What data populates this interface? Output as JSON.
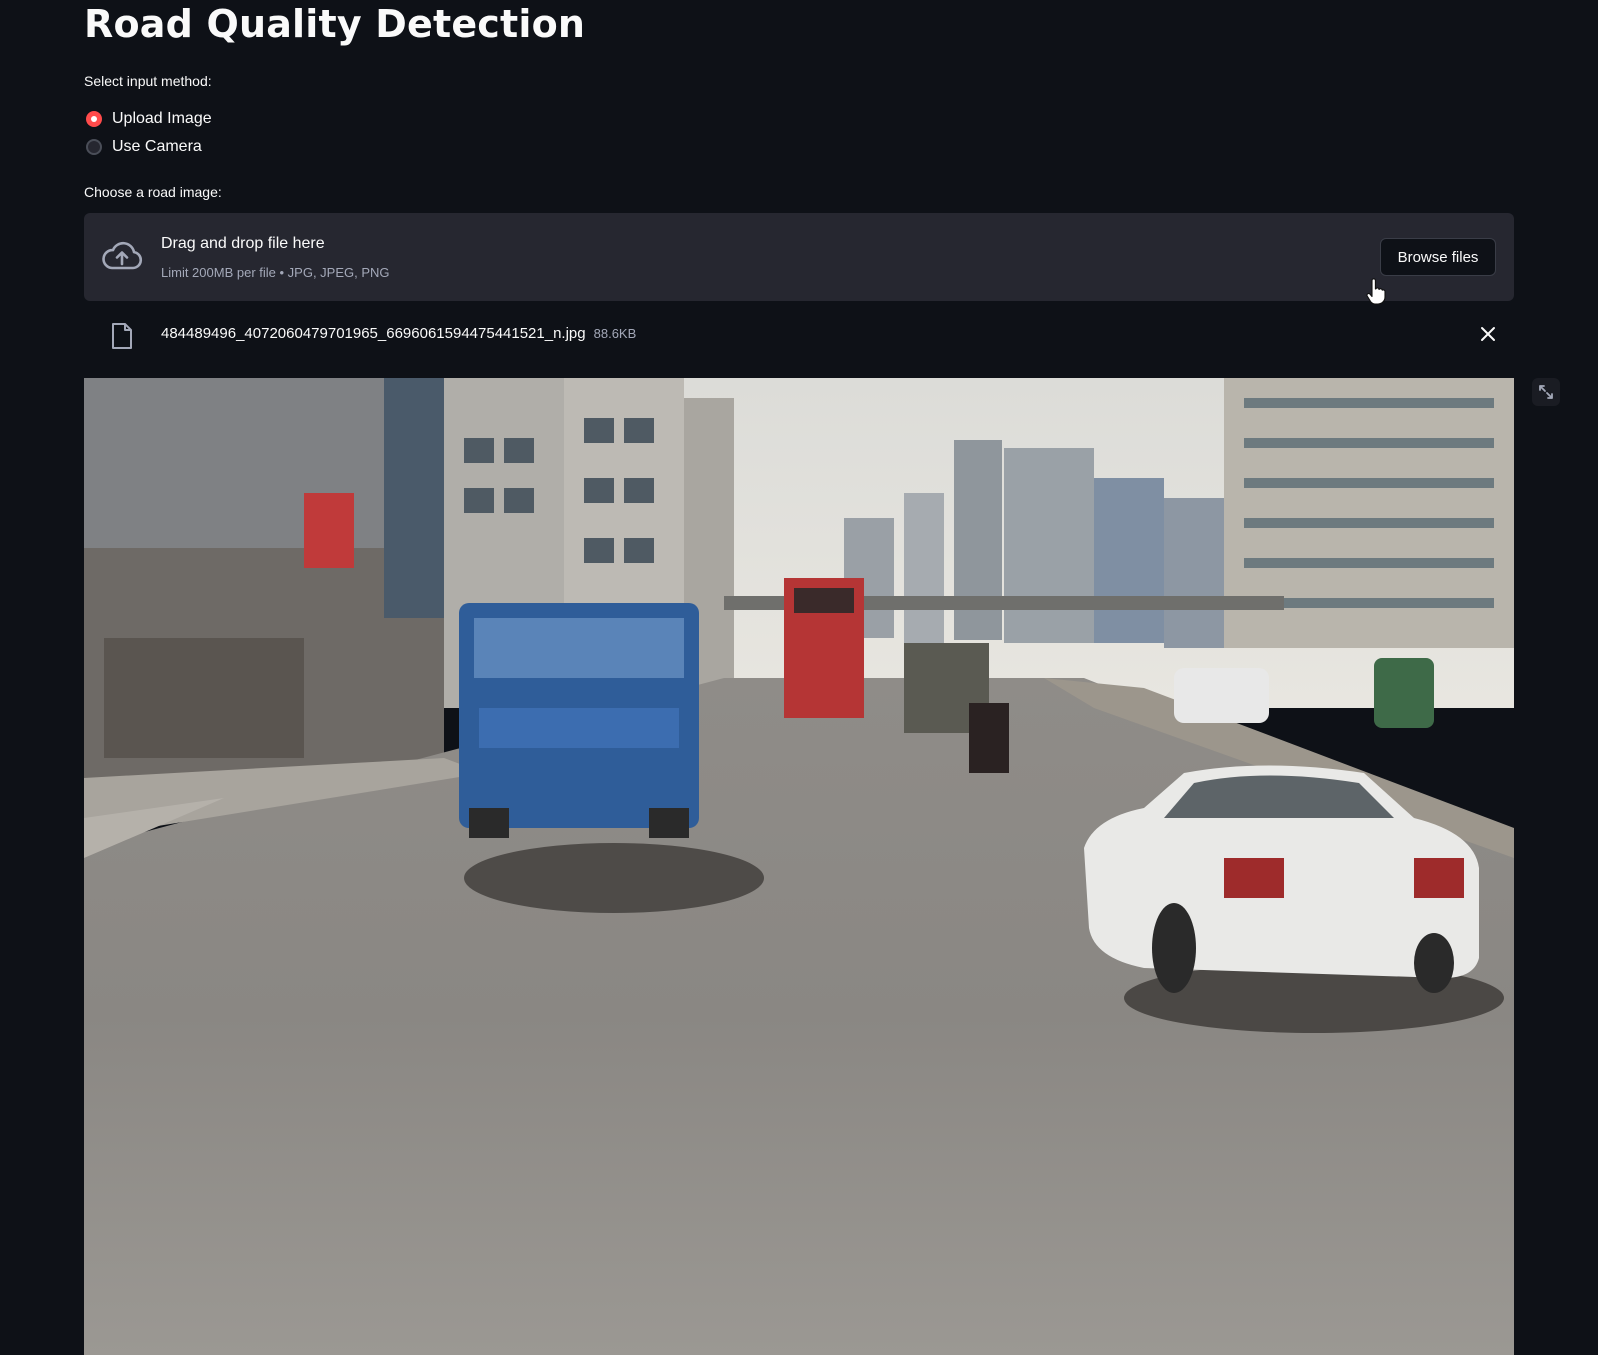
{
  "page": {
    "title": "Road Quality Detection"
  },
  "input_method": {
    "label": "Select input method:",
    "options": [
      {
        "label": "Upload Image",
        "selected": true
      },
      {
        "label": "Use Camera",
        "selected": false
      }
    ]
  },
  "uploader": {
    "label": "Choose a road image:",
    "drop_text": "Drag and drop file here",
    "limit_text": "Limit 200MB per file • JPG, JPEG, PNG",
    "browse_label": "Browse files",
    "icon": "cloud-upload-icon"
  },
  "uploaded_file": {
    "name": "484489496_4072060479701965_6696061594475441521_n.jpg",
    "size": "88.6KB",
    "icon": "file-icon",
    "remove_icon": "close-icon"
  },
  "image_viewer": {
    "fullscreen_icon": "expand-icon"
  },
  "colors": {
    "background": "#0e1117",
    "panel": "#262730",
    "accent": "#ff4b4b",
    "text": "#fafafa",
    "muted": "#a3a8b8"
  }
}
